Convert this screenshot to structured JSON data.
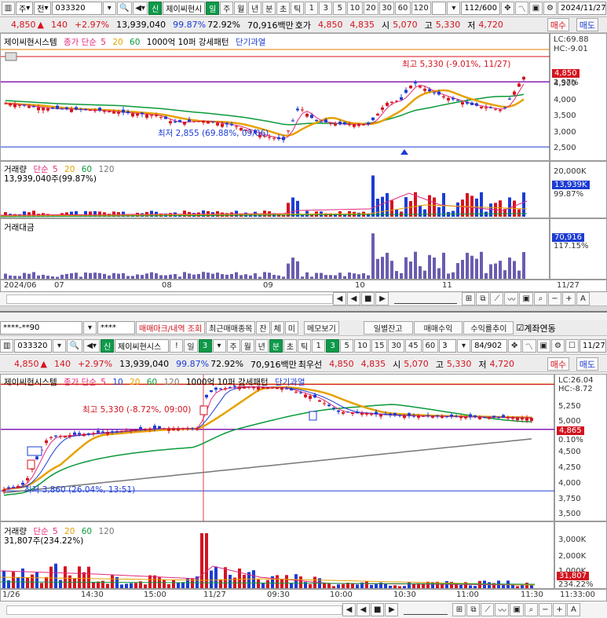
{
  "top": {
    "toolbar": {
      "market": "주",
      "market2": "전",
      "code": "033320",
      "signal_btn": "신",
      "name": "제이씨현시",
      "periods": [
        "일",
        "주",
        "월",
        "년",
        "분",
        "초",
        "틱"
      ],
      "nums": [
        "1",
        "3",
        "5",
        "10",
        "20",
        "30",
        "60",
        "120"
      ],
      "count": "112/600",
      "date": "2024/11/27"
    },
    "quote": {
      "price": "4,850",
      "change": "140",
      "rate": "+2.97%",
      "volume": "13,939,040",
      "vol_ratio": "99.87%",
      "turnover": "72.92%",
      "amount": "70,916백만",
      "hoga_label": "호가",
      "ask": "4,850",
      "bid": "4,835",
      "open_label": "시",
      "open": "5,070",
      "high_label": "고",
      "high": "5,330",
      "low_label": "저",
      "low": "4,720",
      "buy": "매수",
      "sell": "매도"
    },
    "legend": [
      "제이씨현시스템",
      "종가 단순",
      "5",
      "20",
      "60",
      "1000억 10퍼 강세패턴",
      "단기과열"
    ],
    "lc": "LC:69.88",
    "hc": "HC:-9.01",
    "high_ann": "최고 5,330 (-9.01%, 11/27)",
    "low_ann": "최저 2,855 (69.88%, 09/06)",
    "price_tag": "4,850",
    "pct_tag": "2.97%",
    "y_ticks": [
      "4,500",
      "4,000",
      "3,500",
      "3,000",
      "2,500"
    ],
    "vol_legend": [
      "거래량",
      "단순",
      "5",
      "20",
      "60",
      "120"
    ],
    "vol_text": "13,939,040주(99.87%)",
    "vol_ticks": [
      "20,000K",
      "10,000K"
    ],
    "vol_tag": "13,939K",
    "vol_pct": "99.87%",
    "amt_legend": "거래대금",
    "amt_tag": "70,916",
    "amt_pct": "117.15%",
    "x_labels": [
      "2024/06",
      "07",
      "08",
      "09",
      "10",
      "11",
      "11/27"
    ],
    "chart_data": {
      "type": "candlestick",
      "period": "daily",
      "high": {
        "value": 5330,
        "date": "11/27"
      },
      "low": {
        "value": 2855,
        "date": "09/06"
      },
      "last": 4850,
      "ylim": [
        2500,
        5900
      ]
    }
  },
  "bottom": {
    "row1": {
      "acct": "****-**90",
      "pw": "****",
      "btns": [
        "매매마크/내역 조회",
        "최근매매종목",
        "잔",
        "체",
        "미",
        "메모보기",
        "일별잔고",
        "매매수익",
        "수익률추이"
      ],
      "check": "계좌연동"
    },
    "toolbar": {
      "code": "033320",
      "signal_btn": "신",
      "name": "제이씨현시스",
      "periods": [
        "일",
        "3",
        "주",
        "월",
        "년",
        "분",
        "초",
        "틱"
      ],
      "nums": [
        "1",
        "3",
        "5",
        "10",
        "15",
        "30",
        "45",
        "60"
      ],
      "interval": "3",
      "count": "84/902",
      "date": "11/27"
    },
    "quote": {
      "price": "4,850",
      "change": "140",
      "rate": "+2.97%",
      "volume": "13,939,040",
      "vol_ratio": "99.87%",
      "turnover": "72.92%",
      "amount": "70,916백만",
      "best_label": "최우선",
      "ask": "4,850",
      "bid": "4,835",
      "open_label": "시",
      "open": "5,070",
      "high_label": "고",
      "high": "5,330",
      "low_label": "저",
      "low": "4,720",
      "buy": "매수",
      "sell": "매도"
    },
    "legend": [
      "제이씨현시스템",
      "종가 단순",
      "5",
      "10",
      "20",
      "60",
      "120",
      "1000억 10퍼 강세패턴",
      "단기과열"
    ],
    "lc": "LC:26.04",
    "hc": "HC:-8.72",
    "high_ann": "최고 5,330 (-8.72%, 09:00)",
    "low_ann": "최저 3,860 (26.04%, 13:51)",
    "price_tag": "4,865",
    "pct_tag": "0.10%",
    "y_ticks": [
      "5,250",
      "5,000",
      "4,750",
      "4,500",
      "4,250",
      "4,000",
      "3,750",
      "3,500"
    ],
    "vol_legend": [
      "거래량",
      "단순",
      "5",
      "20",
      "60",
      "120"
    ],
    "vol_text": "31,807주(234.22%)",
    "vol_ticks": [
      "3,000K",
      "2,000K",
      "1,000K"
    ],
    "vol_tag": "31,807",
    "vol_pct": "234.22%",
    "x_labels": [
      "1/26",
      "14:30",
      "15:00",
      "11/27",
      "09:30",
      "10:00",
      "10:30",
      "11:00",
      "11:30",
      "11:33:00"
    ],
    "chart_data": {
      "type": "candlestick",
      "period": "3-minute",
      "high": {
        "value": 5330,
        "time": "09:00"
      },
      "low": {
        "value": 3860,
        "time": "13:51"
      },
      "last": 4865,
      "ylim": [
        3450,
        5400
      ]
    }
  }
}
